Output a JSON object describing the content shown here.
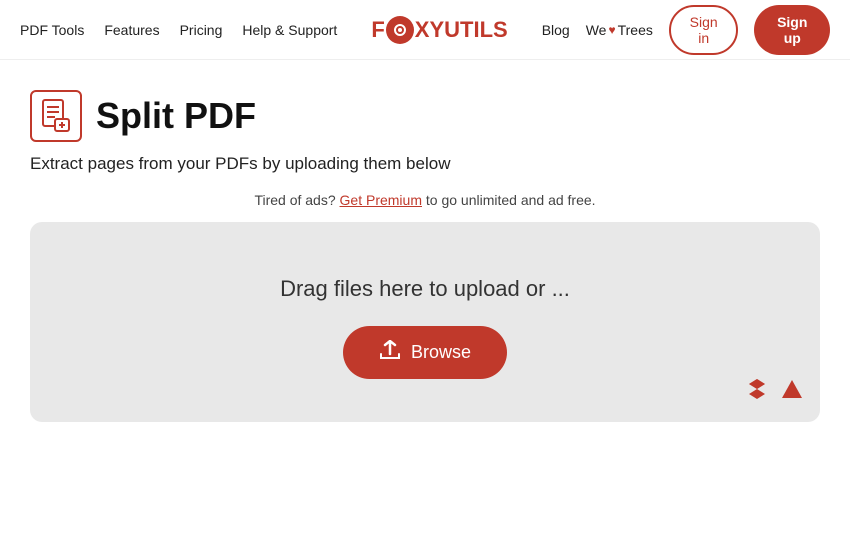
{
  "navbar": {
    "links": [
      {
        "label": "PDF Tools",
        "id": "pdf-tools"
      },
      {
        "label": "Features",
        "id": "features"
      },
      {
        "label": "Pricing",
        "id": "pricing"
      },
      {
        "label": "Help & Support",
        "id": "help-support"
      }
    ],
    "logo_fox": "F",
    "logo_main": "XYUTILS",
    "right_links": [
      {
        "label": "Blog",
        "id": "blog"
      },
      {
        "label": "We",
        "id": "we"
      },
      {
        "label": "Trees",
        "id": "trees"
      }
    ],
    "signin_label": "Sign in",
    "signup_label": "Sign up"
  },
  "main": {
    "page_title": "Split PDF",
    "page_subtitle": "Extract pages from your PDFs by uploading them below",
    "promo_before": "Tired of ads?",
    "promo_link": "Get Premium",
    "promo_after": "to go unlimited and ad free.",
    "dropzone_text": "Drag files here to upload or ...",
    "browse_label": "Browse"
  },
  "icons": {
    "pdf_split": "📄",
    "upload": "☁",
    "dropbox": "✦",
    "drive": "▲"
  }
}
